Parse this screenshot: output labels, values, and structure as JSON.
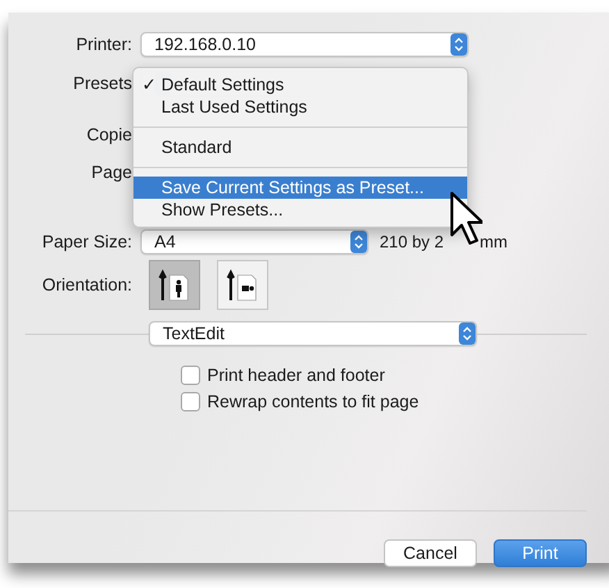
{
  "printer": {
    "label": "Printer:",
    "value": "192.168.0.10"
  },
  "presets": {
    "label": "Presets"
  },
  "copies": {
    "label": "Copie"
  },
  "pages": {
    "label": "Page"
  },
  "presets_menu": {
    "groups": [
      [
        {
          "label": "Default Settings",
          "checked": true,
          "highlighted": false
        },
        {
          "label": "Last Used Settings",
          "checked": false,
          "highlighted": false
        }
      ],
      [
        {
          "label": "Standard",
          "checked": false,
          "highlighted": false
        }
      ],
      [
        {
          "label": "Save Current Settings as Preset...",
          "checked": false,
          "highlighted": true
        },
        {
          "label": "Show Presets...",
          "checked": false,
          "highlighted": false
        }
      ]
    ],
    "check_mark": "✓"
  },
  "paper_size": {
    "label": "Paper Size:",
    "value": "A4",
    "dimensions_start": "210 by 2",
    "dimensions_end": "mm"
  },
  "orientation": {
    "label": "Orientation:",
    "options": [
      {
        "kind": "portrait",
        "selected": true
      },
      {
        "kind": "landscape",
        "selected": false
      }
    ]
  },
  "app_section": {
    "value": "TextEdit"
  },
  "options": [
    {
      "label": "Print header and footer",
      "checked": false
    },
    {
      "label": "Rewrap contents to fit page",
      "checked": false
    }
  ],
  "buttons": [
    {
      "label": "Cancel",
      "kind": "default"
    },
    {
      "label": "Print",
      "kind": "primary"
    }
  ]
}
